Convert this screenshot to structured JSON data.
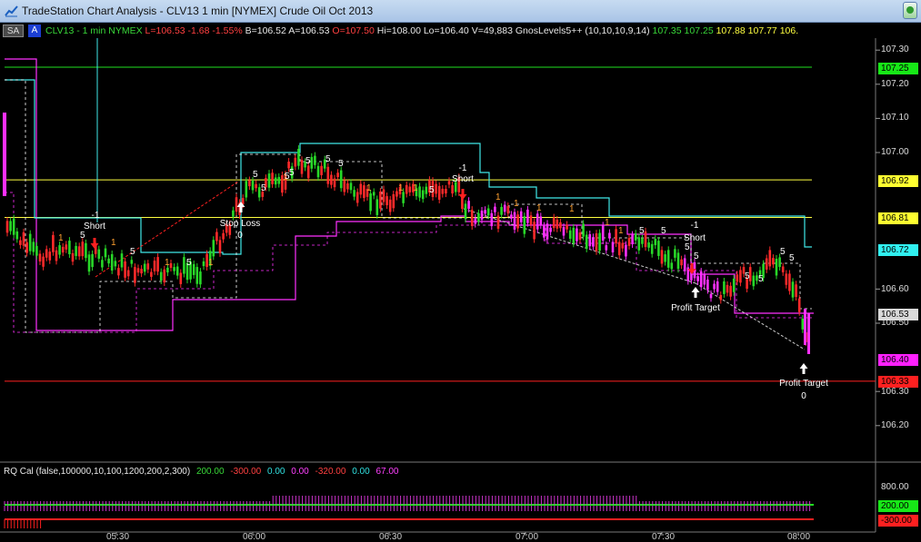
{
  "window": {
    "title": "TradeStation Chart Analysis - CLV13 1 min [NYMEX] Crude Oil Oct 2013",
    "close_icon": "green-orb-icon"
  },
  "toolbar": {
    "sa_label": "SA",
    "a_label": "A"
  },
  "symbol_info": [
    {
      "text": "CLV13 - 1 min",
      "color": "#39d839"
    },
    {
      "text": "NYMEX",
      "color": "#39d839"
    },
    {
      "text": "L=106.53",
      "color": "#ff4040"
    },
    {
      "text": "-1.68",
      "color": "#ff4040"
    },
    {
      "text": "-1.55%",
      "color": "#ff4040"
    },
    {
      "text": "B=106.52",
      "color": "#e8e8e8"
    },
    {
      "text": "A=106.53",
      "color": "#e8e8e8"
    },
    {
      "text": "O=107.50",
      "color": "#ff4040"
    },
    {
      "text": "Hi=108.00",
      "color": "#e8e8e8"
    },
    {
      "text": "Lo=106.40",
      "color": "#e8e8e8"
    },
    {
      "text": "V=49,883",
      "color": "#e8e8e8"
    },
    {
      "text": "GnosLevels5++ (10,10,10,9,14)",
      "color": "#e8e8e8"
    },
    {
      "text": "107.35",
      "color": "#39d839"
    },
    {
      "text": "107.25",
      "color": "#39d839"
    },
    {
      "text": "107.88",
      "color": "#ffff40"
    },
    {
      "text": "107.77",
      "color": "#ffff40"
    },
    {
      "text": "106.",
      "color": "#ffff40"
    }
  ],
  "price_axis": {
    "ticks": [
      "107.30",
      "107.20",
      "107.10",
      "107.00",
      "106.60",
      "106.50",
      "106.30",
      "106.20"
    ],
    "tags": [
      {
        "text": "107.25",
        "bg": "#17e817",
        "fg": "#000"
      },
      {
        "text": "106.92",
        "bg": "#ffff30",
        "fg": "#000"
      },
      {
        "text": "106.81",
        "bg": "#ffff30",
        "fg": "#000"
      },
      {
        "text": "106.72",
        "bg": "#30f0f0",
        "fg": "#000"
      },
      {
        "text": "106.53",
        "bg": "#d9d9d9",
        "fg": "#000"
      },
      {
        "text": "106.40",
        "bg": "#ff20ff",
        "fg": "#000"
      },
      {
        "text": "106.33",
        "bg": "#ff2020",
        "fg": "#000"
      }
    ]
  },
  "indicator_axis": {
    "ticks": [
      "800.00"
    ],
    "tags": [
      {
        "text": "200.00",
        "bg": "#17e817",
        "fg": "#000"
      },
      {
        "text": "-300.00",
        "bg": "#ff2020",
        "fg": "#000"
      }
    ]
  },
  "time_axis": [
    "05:30",
    "06:00",
    "06:30",
    "07:00",
    "07:30",
    "08:00"
  ],
  "indicator_info": [
    {
      "text": "RQ Cal (false,100000,10,100,1200,200,2,300)",
      "color": "#e8e8e8"
    },
    {
      "text": "200.00",
      "color": "#39d839"
    },
    {
      "text": "-300.00",
      "color": "#ff4040"
    },
    {
      "text": "0.00",
      "color": "#30e0e0"
    },
    {
      "text": "0.00",
      "color": "#ff40ff"
    },
    {
      "text": "-320.00",
      "color": "#ff4040"
    },
    {
      "text": "0.00",
      "color": "#30e0e0"
    },
    {
      "text": "67.00",
      "color": "#ff40ff"
    }
  ],
  "trade_labels": {
    "short_1": "Short",
    "short_1_qty": "-1",
    "stop_loss": "Stop Loss",
    "stop_loss_qty": "0",
    "short_2": "Short",
    "short_2_qty": "-1",
    "short_3": "Short",
    "short_3_qty": "-1",
    "profit_target_1": "Profit Target",
    "profit_target_2": "Profit Target",
    "profit_target_2_qty": "0"
  },
  "level_colors": {
    "green": "#20e020",
    "yellow": "#ffff40",
    "cyan": "#40e8e8",
    "magenta": "#ff30ff",
    "red": "#ff2020"
  }
}
